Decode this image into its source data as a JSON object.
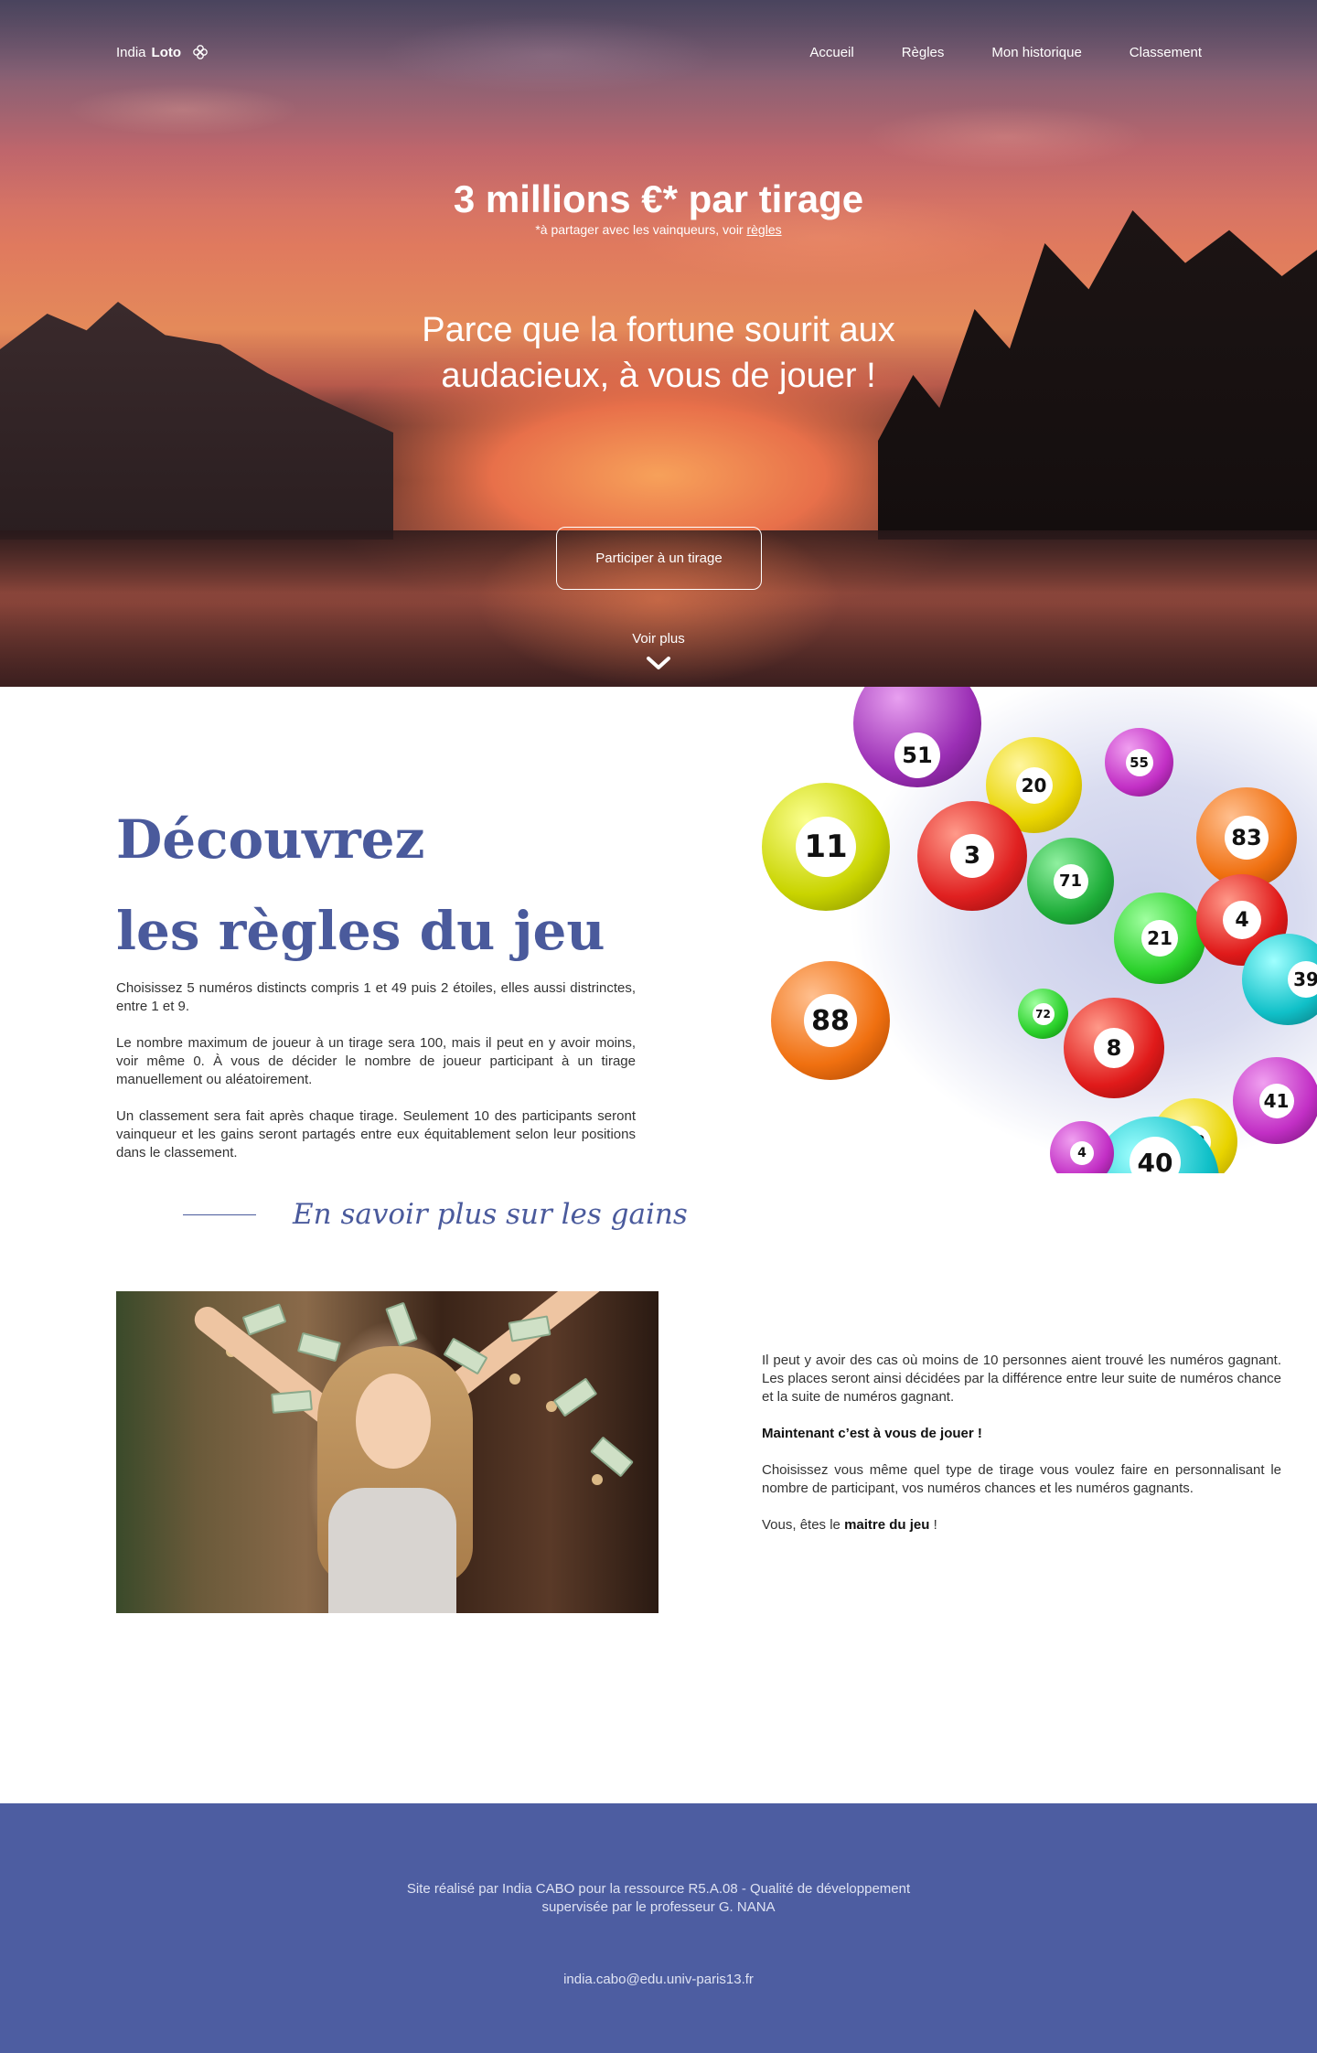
{
  "nav": {
    "logo_prefix": "India",
    "logo_bold": "Loto",
    "logo_icon": "clover-icon",
    "links": [
      "Accueil",
      "Règles",
      "Mon historique",
      "Classement"
    ]
  },
  "hero": {
    "title": "3 millions €* par tirage",
    "subtitle_prefix": "*à partager avec les vainqueurs, voir",
    "subtitle_link": "règles",
    "tagline": "Parce que la fortune sourit aux audacieux, à vous de jouer !",
    "cta_label": "Participer à un tirage",
    "more_label": "Voir plus",
    "more_icon": "chevron-down-icon"
  },
  "rules": {
    "title_line1": "Découvrez",
    "title_line2_light": "les",
    "title_line2_bold": "règles du jeu",
    "paragraphs": [
      "Choisissez  5 numéros distincts compris 1 et 49 puis 2 étoiles, elles aussi distrinctes, entre 1 et 9.",
      "Le nombre maximum de joueur à un tirage sera 100, mais il peut en y avoir moins, voir même 0. À vous de décider le nombre de joueur participant à un tirage manuellement ou aléatoirement.",
      "Un classement sera fait après chaque tirage. Seulement 10 des participants seront vainqueur et les gains seront partagés entre eux équitablement selon leur positions dans le classement."
    ],
    "gains_link": "En savoir plus sur les gains",
    "ball_numbers": [
      "51",
      "20",
      "55",
      "11",
      "3",
      "71",
      "83",
      "21",
      "4",
      "39",
      "88",
      "8",
      "41",
      "12",
      "40",
      "72",
      "4"
    ]
  },
  "gains": {
    "paragraph1": "Il peut y avoir des cas où moins de 10 personnes aient trouvé les numéros gagnant. Les places seront ainsi décidées par la différence entre leur suite de numéros chance et la suite de numéros gagnant.",
    "heading": "Maintenant c’est à vous de jouer !",
    "paragraph2": "Choisissez vous même quel type de tirage vous voulez faire en personnalisant le nombre de participant, vos numéros chances et les numéros gagnants.",
    "closing_prefix": "Vous, êtes le",
    "closing_bold": "maitre du jeu",
    "closing_suffix": "!"
  },
  "footer": {
    "credit_line1": "Site réalisé par India CABO pour la ressource R5.A.08 - Qualité de développement",
    "credit_line2": "supervisée par le professeur G. NANA",
    "email": "india.cabo@edu.univ-paris13.fr"
  },
  "colors": {
    "accent": "#4a5a9c",
    "footer_bg": "#4d5da1"
  }
}
